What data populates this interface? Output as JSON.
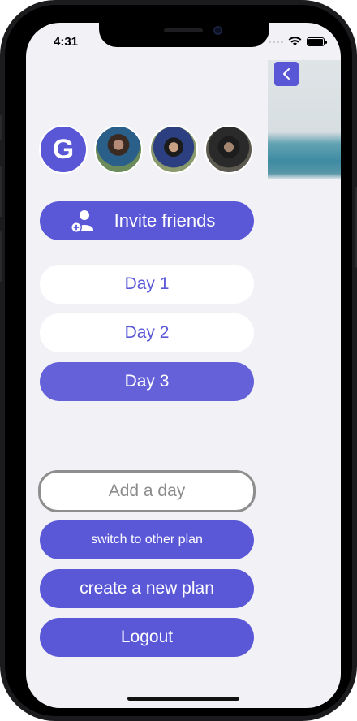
{
  "status_bar": {
    "time": "4:31"
  },
  "header": {
    "back_icon": "chevron-left-icon"
  },
  "members": {
    "initial": "G",
    "photos": [
      "member-photo",
      "member-photo",
      "member-photo"
    ]
  },
  "actions": {
    "invite_label": "Invite friends",
    "days": [
      {
        "label": "Day 1",
        "selected": false
      },
      {
        "label": "Day 2",
        "selected": false
      },
      {
        "label": "Day 3",
        "selected": true
      }
    ],
    "add_day_label": "Add a day",
    "switch_plan_label": "switch to other plan",
    "new_plan_label": "create a new plan",
    "logout_label": "Logout"
  },
  "colors": {
    "accent": "#5b58d8",
    "background": "#f2f1f6",
    "outline": "#8e8e8e"
  }
}
